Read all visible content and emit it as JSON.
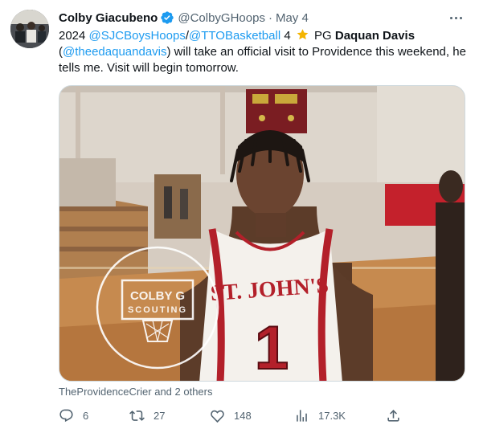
{
  "author": {
    "display_name": "Colby Giacubeno",
    "handle": "@ColbyGHoops",
    "date": "May 4",
    "separator": "·"
  },
  "tweet": {
    "t1": "2024 ",
    "m1": "@SJCBoysHoops",
    "t2": "/",
    "m2": "@TTOBasketball",
    "t3": " 4 ",
    "t4": " PG ",
    "name_bold": "Daquan Davis",
    "t5": " (",
    "m3": "@theedaquandavis",
    "t6": ") will take an official visit to Providence this weekend, he tells me. Visit will begin tomorrow."
  },
  "media": {
    "jersey_text": "ST. JOHN'S",
    "jersey_number": "1",
    "watermark_line1": "COLBY G",
    "watermark_line2": "SCOUTING"
  },
  "social_context": "TheProvidenceCrier and 2 others",
  "actions": {
    "replies": "6",
    "retweets": "27",
    "likes": "148",
    "views": "17.3K"
  },
  "colors": {
    "link": "#1d9bf0",
    "secondary": "#536471",
    "verified": "#1d9bf0",
    "jersey_red": "#b3202a"
  },
  "icons": [
    "verified-badge-icon",
    "more-icon",
    "star-icon",
    "reply-icon",
    "retweet-icon",
    "like-icon",
    "views-icon",
    "share-icon"
  ]
}
